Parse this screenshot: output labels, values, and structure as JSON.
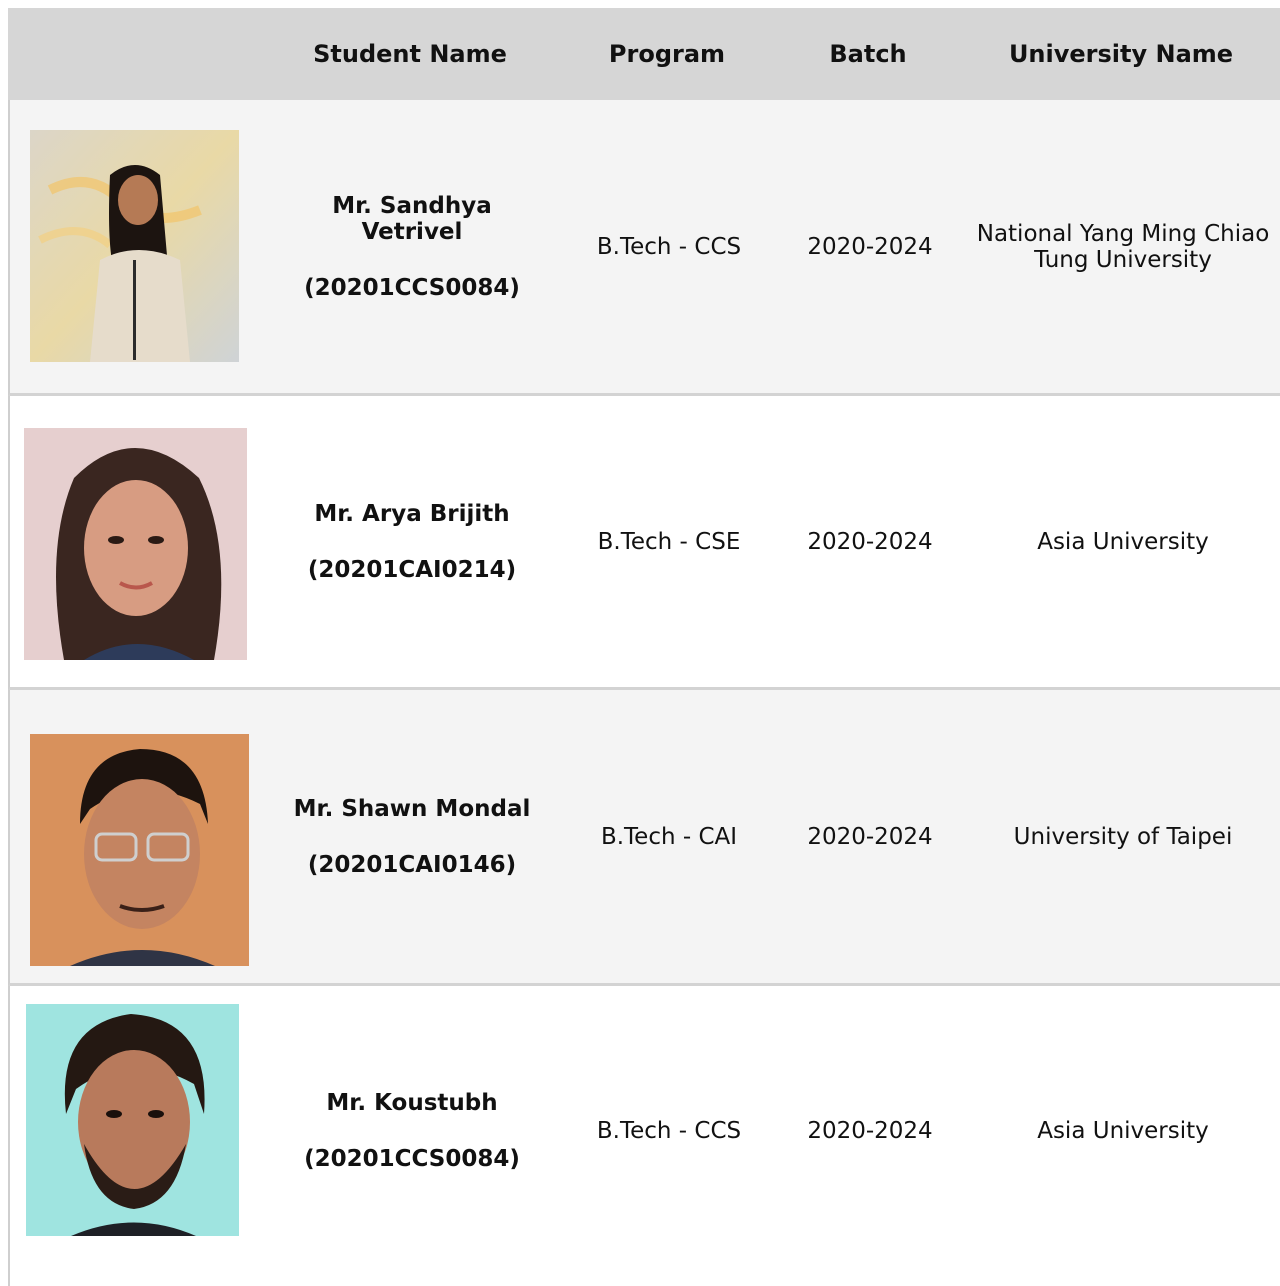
{
  "table": {
    "headers": {
      "photo": "",
      "student_name": "Student Name",
      "program": "Program",
      "batch": "Batch",
      "university": "University Name"
    },
    "rows": [
      {
        "name": "Mr. Sandhya Vetrivel",
        "id": "(20201CCS0084)",
        "program": "B.Tech - CCS",
        "batch": "2020-2024",
        "university": "National Yang Ming Chiao Tung University"
      },
      {
        "name": "Mr. Arya Brijith",
        "id": "(20201CAI0214)",
        "program": "B.Tech - CSE",
        "batch": "2020-2024",
        "university": "Asia University"
      },
      {
        "name": "Mr. Shawn Mondal",
        "id": "(20201CAI0146)",
        "program": "B.Tech - CAI",
        "batch": "2020-2024",
        "university": "University of Taipei"
      },
      {
        "name": "Mr. Koustubh",
        "id": "(20201CCS0084)",
        "program": "B.Tech - CCS",
        "batch": "2020-2024",
        "university": "Asia University"
      }
    ]
  },
  "colors": {
    "header_bg": "#d6d6d6",
    "row_alt_bg": "#f4f4f4",
    "row_bg": "#ffffff",
    "border": "#d3d3d3"
  }
}
